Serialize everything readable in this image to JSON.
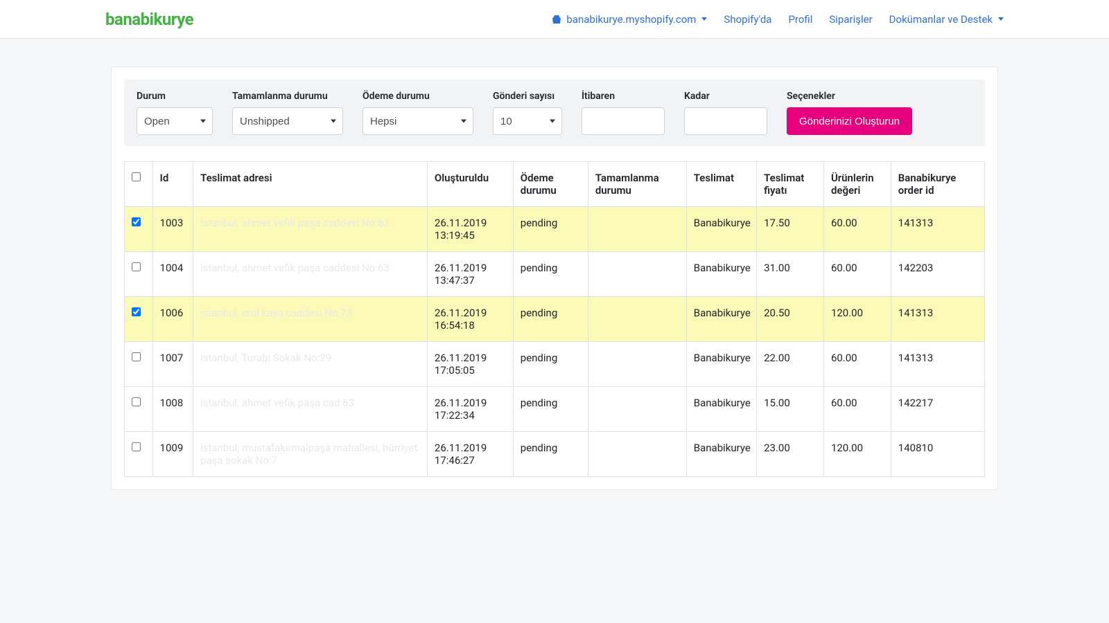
{
  "brand": "banabikurye",
  "nav": {
    "shop_url": "banabikurye.myshopify.com",
    "shopify": "Shopify'da",
    "profile": "Profil",
    "orders": "Siparişler",
    "docs": "Dokümanlar ve Destek"
  },
  "filters": {
    "status_label": "Durum",
    "status_value": "Open",
    "completion_label": "Tamamlanma durumu",
    "completion_value": "Unshipped",
    "payment_label": "Ödeme durumu",
    "payment_value": "Hepsi",
    "count_label": "Gönderi sayısı",
    "count_value": "10",
    "from_label": "İtibaren",
    "from_value": "",
    "to_label": "Kadar",
    "to_value": "",
    "options_label": "Seçenekler",
    "submit_label": "Gönderinizi Oluşturun"
  },
  "columns": {
    "check": "",
    "id": "Id",
    "address": "Teslimat adresi",
    "created": "Oluşturuldu",
    "payment_status": "Ödeme durumu",
    "completion_status": "Tamamlanma durumu",
    "delivery": "Teslimat",
    "delivery_price": "Teslimat fiyatı",
    "product_value": "Ürünlerin değeri",
    "bk_order_id": "Banabikurye order id"
  },
  "rows": [
    {
      "selected": true,
      "id": "1003",
      "address": "istanbul, ahmet vefik paşa caddesi No:63",
      "created": "26.11.2019 13:19:45",
      "payment": "pending",
      "completion": "",
      "delivery": "Banabikurye",
      "price": "17.50",
      "value": "60.00",
      "bk_id": "141313"
    },
    {
      "selected": false,
      "id": "1004",
      "address": "istanbul, ahmet vefik paşa caddesi No:63",
      "created": "26.11.2019 13:47:37",
      "payment": "pending",
      "completion": "",
      "delivery": "Banabikurye",
      "price": "31.00",
      "value": "60.00",
      "bk_id": "142203"
    },
    {
      "selected": true,
      "id": "1006",
      "address": "istanbul, erol kaya caddesi No:73",
      "created": "26.11.2019 16:54:18",
      "payment": "pending",
      "completion": "",
      "delivery": "Banabikurye",
      "price": "20.50",
      "value": "120.00",
      "bk_id": "141313"
    },
    {
      "selected": false,
      "id": "1007",
      "address": "istanbul, Turabi Sokak No:29",
      "created": "26.11.2019 17:05:05",
      "payment": "pending",
      "completion": "",
      "delivery": "Banabikurye",
      "price": "22.00",
      "value": "60.00",
      "bk_id": "141313"
    },
    {
      "selected": false,
      "id": "1008",
      "address": "istanbul, ahmet vefik paşa cad:63",
      "created": "26.11.2019 17:22:34",
      "payment": "pending",
      "completion": "",
      "delivery": "Banabikurye",
      "price": "15.00",
      "value": "60.00",
      "bk_id": "142217"
    },
    {
      "selected": false,
      "id": "1009",
      "address": "istanbul, mustafakemalpaşa mahallesi, hürriyet paşa sokak No:7",
      "created": "26.11.2019 17:46:27",
      "payment": "pending",
      "completion": "",
      "delivery": "Banabikurye",
      "price": "23.00",
      "value": "120.00",
      "bk_id": "140810"
    }
  ]
}
